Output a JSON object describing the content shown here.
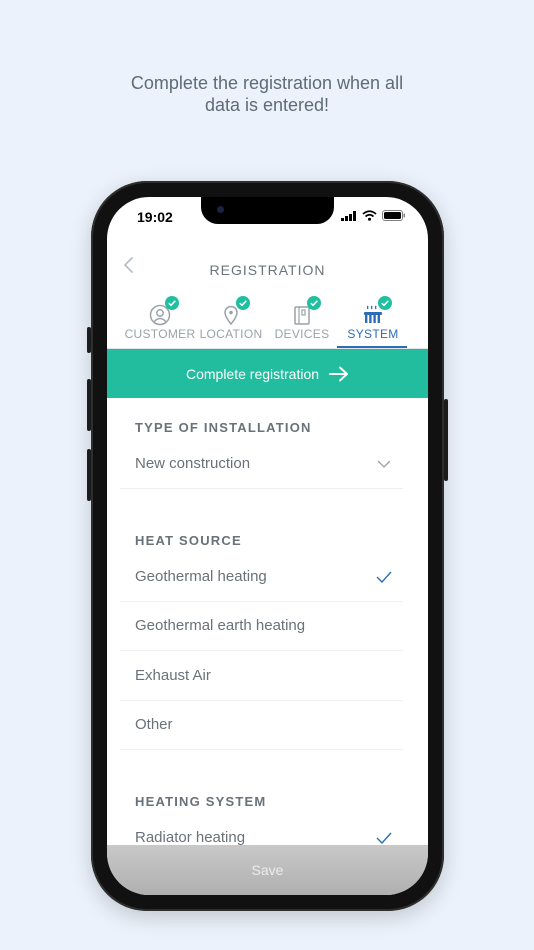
{
  "headline": {
    "line1": "Complete the registration when all",
    "line2": "data is entered!"
  },
  "status_bar": {
    "time": "19:02",
    "icons": [
      "signal-icon",
      "wifi-icon",
      "battery-icon"
    ]
  },
  "header": {
    "title": "REGISTRATION",
    "back_icon": "chevron-left-icon"
  },
  "tabs": [
    {
      "label": "CUSTOMER",
      "icon": "user-circle-icon",
      "completed": true,
      "active": false
    },
    {
      "label": "LOCATION",
      "icon": "map-pin-icon",
      "completed": true,
      "active": false
    },
    {
      "label": "DEVICES",
      "icon": "device-icon",
      "completed": true,
      "active": false
    },
    {
      "label": "SYSTEM",
      "icon": "radiator-icon",
      "completed": true,
      "active": true
    }
  ],
  "cta": {
    "label": "Complete registration",
    "icon": "arrow-right-icon"
  },
  "installation": {
    "heading": "TYPE OF INSTALLATION",
    "value": "New construction",
    "icon": "chevron-down-icon"
  },
  "heat_source": {
    "heading": "HEAT SOURCE",
    "options": [
      {
        "label": "Geothermal heating",
        "selected": true
      },
      {
        "label": "Geothermal earth heating",
        "selected": false
      },
      {
        "label": "Exhaust Air",
        "selected": false
      },
      {
        "label": "Other",
        "selected": false
      }
    ]
  },
  "heating_system": {
    "heading": "HEATING SYSTEM",
    "options": [
      {
        "label": "Radiator heating",
        "selected": true
      }
    ]
  },
  "save": {
    "label": "Save"
  },
  "colors": {
    "accent": "#22bc9e",
    "active_tab": "#2d6db8",
    "background": "#ebf2fb",
    "text_muted": "#6a7178"
  }
}
